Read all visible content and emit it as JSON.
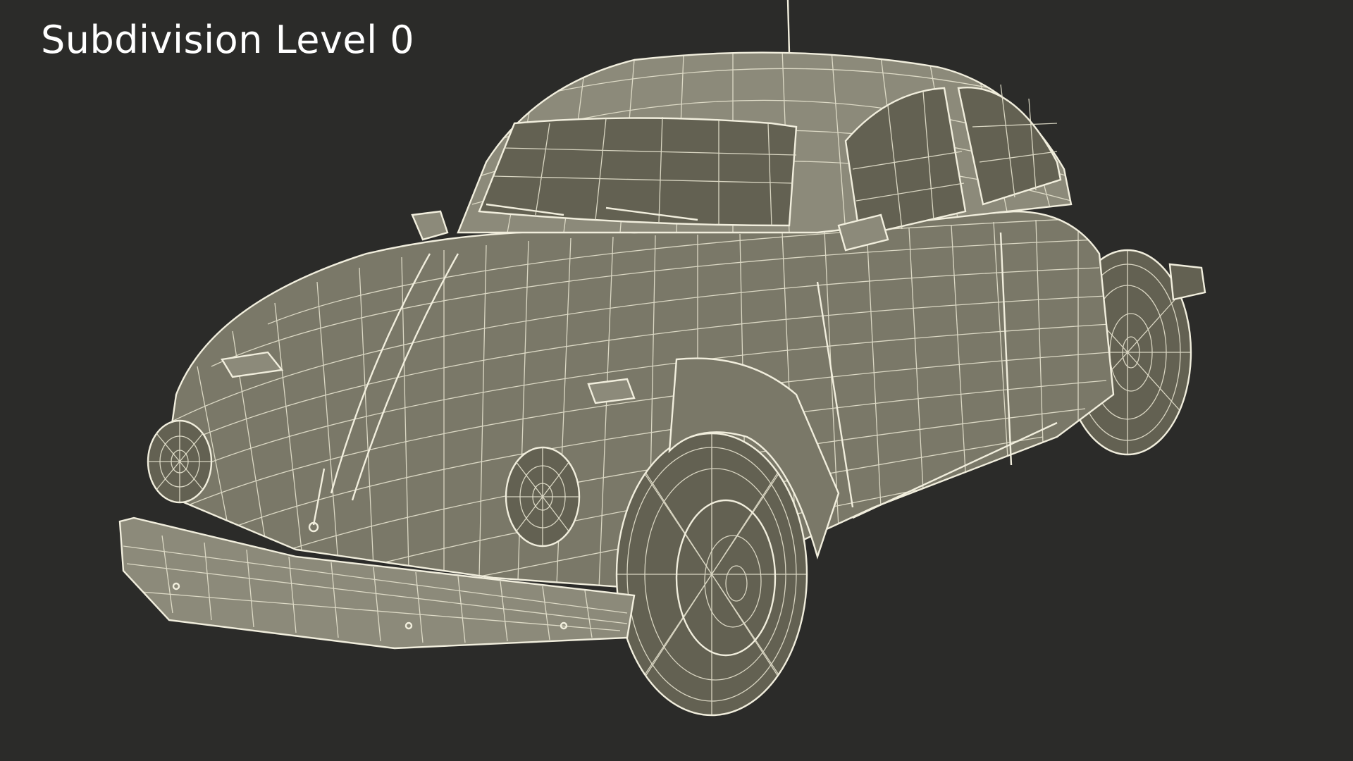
{
  "overlay": {
    "subdivision_label": "Subdivision Level 0"
  },
  "colors": {
    "background": "#2b2b29",
    "mesh_fill": "#7a7868",
    "wireframe": "#e6e3cf",
    "label": "#ffffff"
  }
}
